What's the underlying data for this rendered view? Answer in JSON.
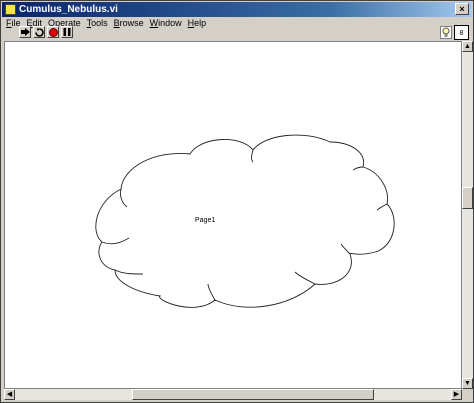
{
  "window": {
    "title": "Cumulus_Nebulus.vi"
  },
  "menubar": {
    "items": [
      {
        "label": "File",
        "ul": "F",
        "rest": "ile"
      },
      {
        "label": "Edit",
        "ul": "E",
        "rest": "dit"
      },
      {
        "label": "Operate",
        "ul": "O",
        "rest": "perate"
      },
      {
        "label": "Tools",
        "ul": "T",
        "rest": "ools"
      },
      {
        "label": "Browse",
        "ul": "B",
        "rest": "rowse"
      },
      {
        "label": "Window",
        "ul": "W",
        "rest": "indow"
      },
      {
        "label": "Help",
        "ul": "H",
        "rest": "elp"
      }
    ]
  },
  "toolbar": {
    "tools": [
      "run-icon",
      "run-continuously-icon",
      "abort-icon",
      "pause-icon"
    ],
    "vi_icon_text": "8"
  },
  "panel": {
    "page_label": "Page1"
  },
  "colors": {
    "titlebar_start": "#0a246a",
    "abort_red": "#e00000"
  }
}
